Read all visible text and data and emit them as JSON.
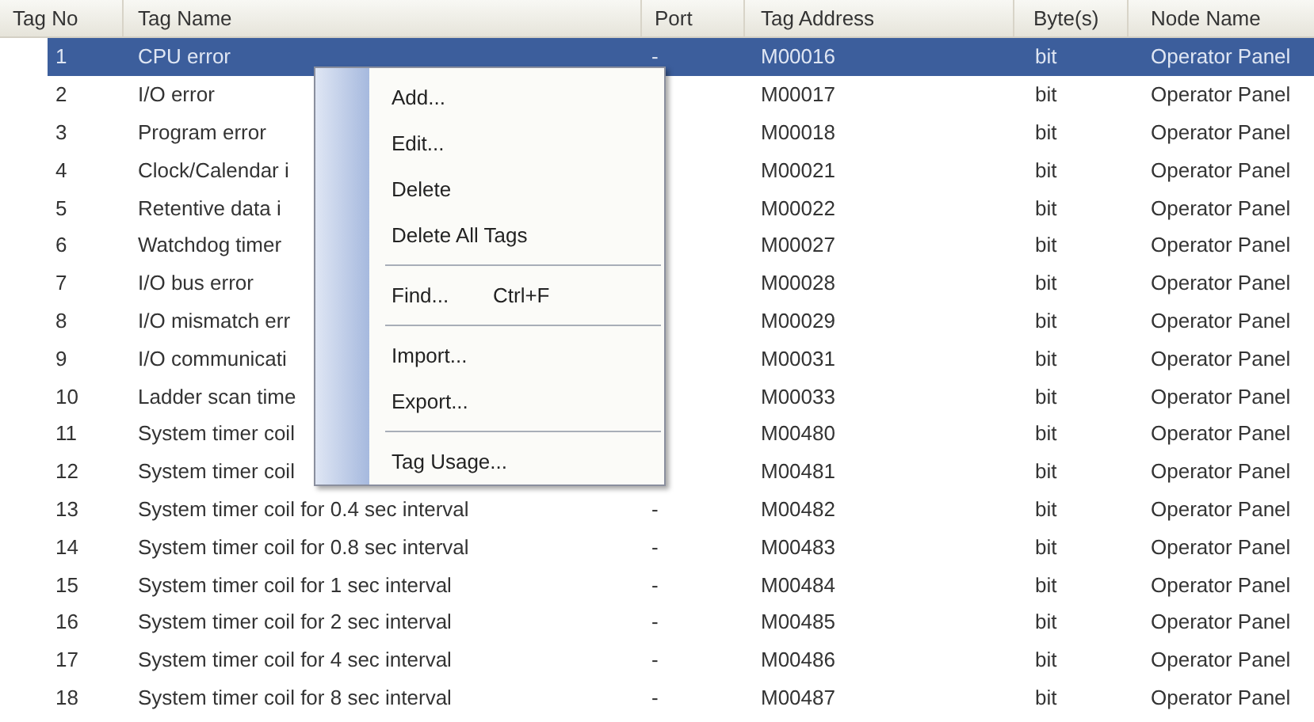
{
  "table": {
    "columns": [
      "Tag No",
      "Tag Name",
      "Port",
      "Tag Address",
      "Byte(s)",
      "Node Name"
    ],
    "rows": [
      {
        "no": "1",
        "name": "CPU error",
        "port": "-",
        "address": "M00016",
        "bytes": "bit",
        "node": "Operator Panel",
        "selected": true
      },
      {
        "no": "2",
        "name": "I/O error",
        "address": "M00017",
        "bytes": "bit",
        "node": "Operator Panel",
        "selected": false
      },
      {
        "no": "3",
        "name": "Program error",
        "address": "M00018",
        "bytes": "bit",
        "node": "Operator Panel",
        "selected": false
      },
      {
        "no": "4",
        "name": "Clock/Calendar i",
        "address": "M00021",
        "bytes": "bit",
        "node": "Operator Panel",
        "selected": false
      },
      {
        "no": "5",
        "name": "Retentive data i",
        "address": "M00022",
        "bytes": "bit",
        "node": "Operator Panel",
        "selected": false
      },
      {
        "no": "6",
        "name": "Watchdog timer",
        "address": "M00027",
        "bytes": "bit",
        "node": "Operator Panel",
        "selected": false
      },
      {
        "no": "7",
        "name": "I/O bus error",
        "address": "M00028",
        "bytes": "bit",
        "node": "Operator Panel",
        "selected": false
      },
      {
        "no": "8",
        "name": "I/O mismatch err",
        "address": "M00029",
        "bytes": "bit",
        "node": "Operator Panel",
        "selected": false
      },
      {
        "no": "9",
        "name": "I/O communicati",
        "address": "M00031",
        "bytes": "bit",
        "node": "Operator Panel",
        "selected": false
      },
      {
        "no": "10",
        "name": "Ladder scan time",
        "address": "M00033",
        "bytes": "bit",
        "node": "Operator Panel",
        "selected": false
      },
      {
        "no": "11",
        "name": "System timer coil",
        "address": "M00480",
        "bytes": "bit",
        "node": "Operator Panel",
        "selected": false
      },
      {
        "no": "12",
        "name": "System timer coil",
        "address": "M00481",
        "bytes": "bit",
        "node": "Operator Panel",
        "selected": false
      },
      {
        "no": "13",
        "name": "System timer coil for 0.4 sec interval",
        "port": "-",
        "address": "M00482",
        "bytes": "bit",
        "node": "Operator Panel",
        "selected": false
      },
      {
        "no": "14",
        "name": "System timer coil for 0.8 sec interval",
        "port": "-",
        "address": "M00483",
        "bytes": "bit",
        "node": "Operator Panel",
        "selected": false
      },
      {
        "no": "15",
        "name": "System timer coil for 1 sec interval",
        "port": "-",
        "address": "M00484",
        "bytes": "bit",
        "node": "Operator Panel",
        "selected": false
      },
      {
        "no": "16",
        "name": "System timer coil for 2 sec interval",
        "port": "-",
        "address": "M00485",
        "bytes": "bit",
        "node": "Operator Panel",
        "selected": false
      },
      {
        "no": "17",
        "name": "System timer coil for 4 sec interval",
        "port": "-",
        "address": "M00486",
        "bytes": "bit",
        "node": "Operator Panel",
        "selected": false
      },
      {
        "no": "18",
        "name": "System timer coil for 8 sec interval",
        "port": "-",
        "address": "M00487",
        "bytes": "bit",
        "node": "Operator Panel",
        "selected": false
      }
    ]
  },
  "context_menu": {
    "items": [
      {
        "kind": "item",
        "label": "Add..."
      },
      {
        "kind": "item",
        "label": "Edit..."
      },
      {
        "kind": "item",
        "label": "Delete"
      },
      {
        "kind": "item",
        "label": "Delete All Tags"
      },
      {
        "kind": "separator"
      },
      {
        "kind": "item",
        "label": "Find...",
        "shortcut": "Ctrl+F"
      },
      {
        "kind": "separator"
      },
      {
        "kind": "item",
        "label": "Import..."
      },
      {
        "kind": "item",
        "label": "Export..."
      },
      {
        "kind": "separator"
      },
      {
        "kind": "item",
        "label": "Tag Usage..."
      }
    ]
  }
}
